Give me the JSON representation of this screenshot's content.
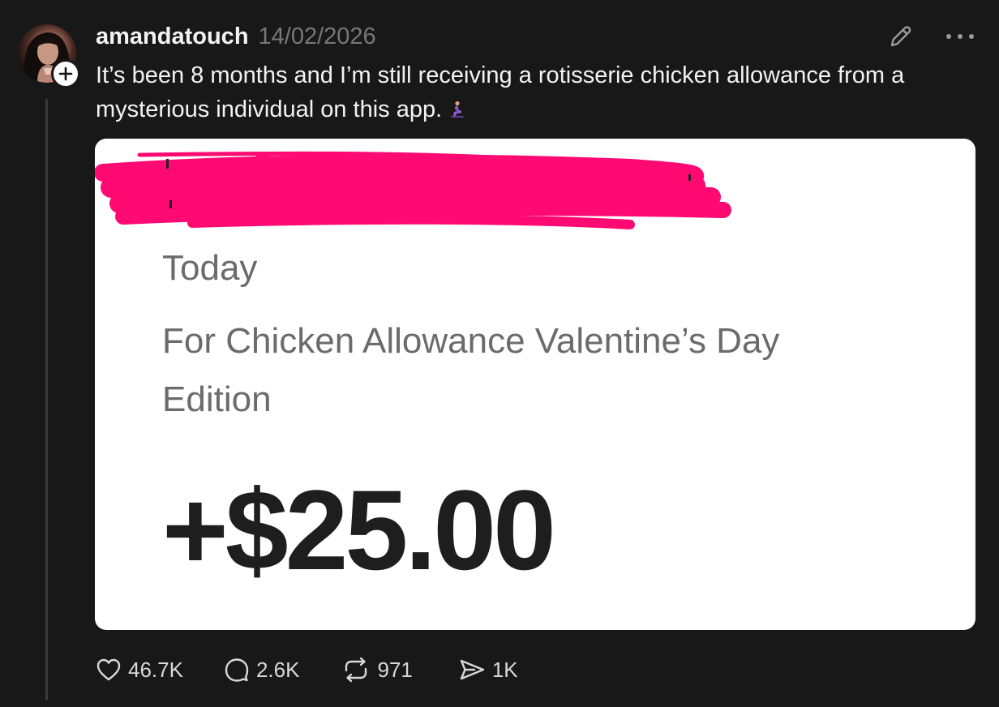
{
  "post": {
    "author": {
      "username": "amandatouch",
      "avatar_icon": "profile-avatar",
      "follow_icon": "plus-icon"
    },
    "timestamp": "14/02/2026",
    "text": "It’s been 8 months and I’m still receiving a rotisserie chicken allowance from a mysterious individual on this app.",
    "emoji_icon": "person-kneeling-emoji",
    "header_icons": [
      "pencil-icon",
      "more-icon"
    ],
    "image": {
      "redaction_color": "#ff0a73",
      "date_label": "Today",
      "memo": "For Chicken Allowance Valentine’s Day Edition",
      "amount": "+$25.00"
    },
    "actions": {
      "like_count": "46.7K",
      "reply_count": "2.6K",
      "repost_count": "971",
      "share_count": "1K"
    }
  }
}
